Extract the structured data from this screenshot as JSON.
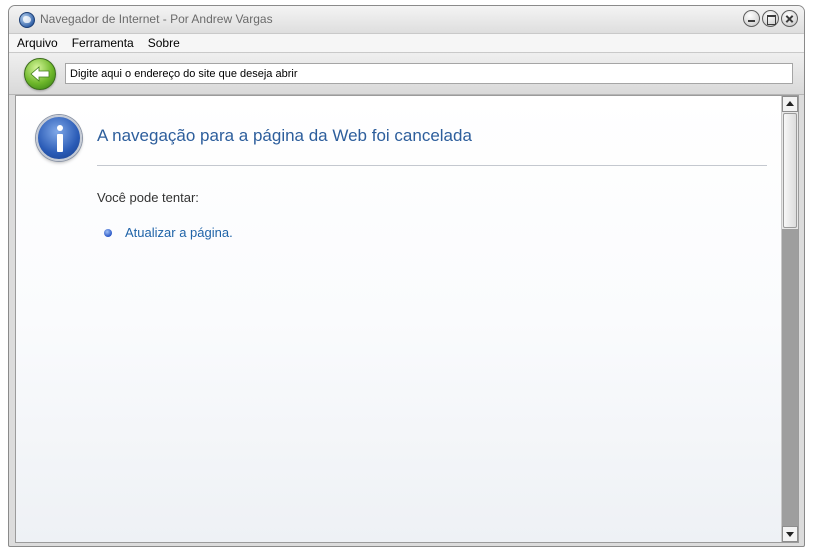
{
  "window": {
    "title": "Navegador de Internet - Por Andrew Vargas"
  },
  "menu": {
    "items": [
      "Arquivo",
      "Ferramenta",
      "Sobre"
    ]
  },
  "toolbar": {
    "address_placeholder": "Digite aqui o endereço do site que deseja abrir"
  },
  "page": {
    "title": "A navegação para a página da Web foi cancelada",
    "suggestion_intro": "Você pode tentar:",
    "suggestion_link": "Atualizar a página."
  },
  "icons": {
    "app": "globe-icon",
    "back": "back-arrow-icon",
    "info": "info-icon",
    "minimize": "minimize-icon",
    "maximize": "maximize-icon",
    "close": "close-icon"
  },
  "colors": {
    "title_blue": "#2d5e9c",
    "link_blue": "#1f63a8",
    "back_green": "#6fb82b"
  }
}
